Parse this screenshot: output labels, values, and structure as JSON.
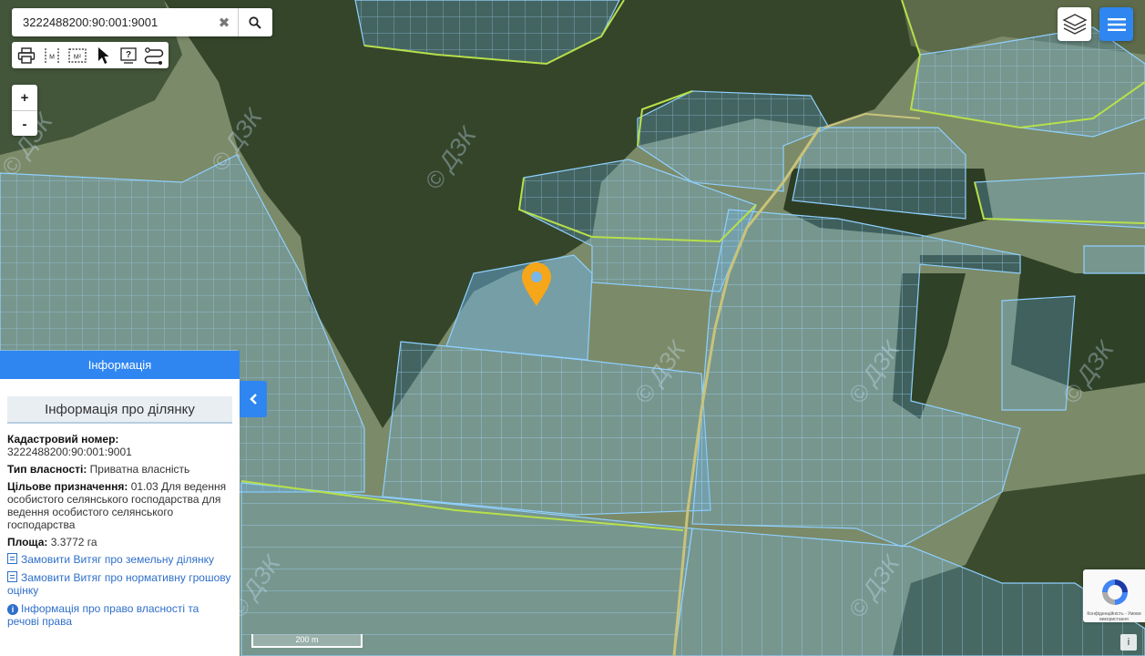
{
  "search": {
    "value": "3222488200:90:001:9001",
    "clear_glyph": "✖",
    "search_icon": "search-icon"
  },
  "toolbar": {
    "tools": [
      "print-icon",
      "measure-distance-icon",
      "measure-area-icon",
      "pointer-icon",
      "help-icon",
      "route-icon"
    ],
    "measure_distance_unit": "M",
    "measure_area_unit": "M²"
  },
  "zoom": {
    "in_label": "+",
    "out_label": "-"
  },
  "info_panel": {
    "header": "Інформація",
    "subtitle": "Інформація про ділянку",
    "cadastral_label": "Кадастровий номер:",
    "cadastral_value": "3222488200:90:001:9001",
    "ownership_label": "Тип власності:",
    "ownership_value": "Приватна власність",
    "purpose_label": "Цільове призначення:",
    "purpose_value": "01.03 Для ведення особистого селянського господарства для ведення особистого селянського господарства",
    "area_label": "Площа:",
    "area_value": "3.3772 га",
    "link1": "Замовити Витяг про земельну ділянку",
    "link2": "Замовити Витяг про нормативну грошову оцінку",
    "link3": "Інформація про право власності та речові права"
  },
  "map": {
    "watermark": "© ДЗК",
    "scale_label": "200 m",
    "recaptcha_text": "Конфіденційність - Умови використання",
    "attribution_label": "i",
    "colors": {
      "forest": "#34452a",
      "field": "#7a8a6a",
      "parcel_fill": "#6fb6f2",
      "parcel_line": "#8fd0ff",
      "boundary": "#b6e04a",
      "road": "#c9c37a",
      "pin": "#f6a619"
    }
  }
}
